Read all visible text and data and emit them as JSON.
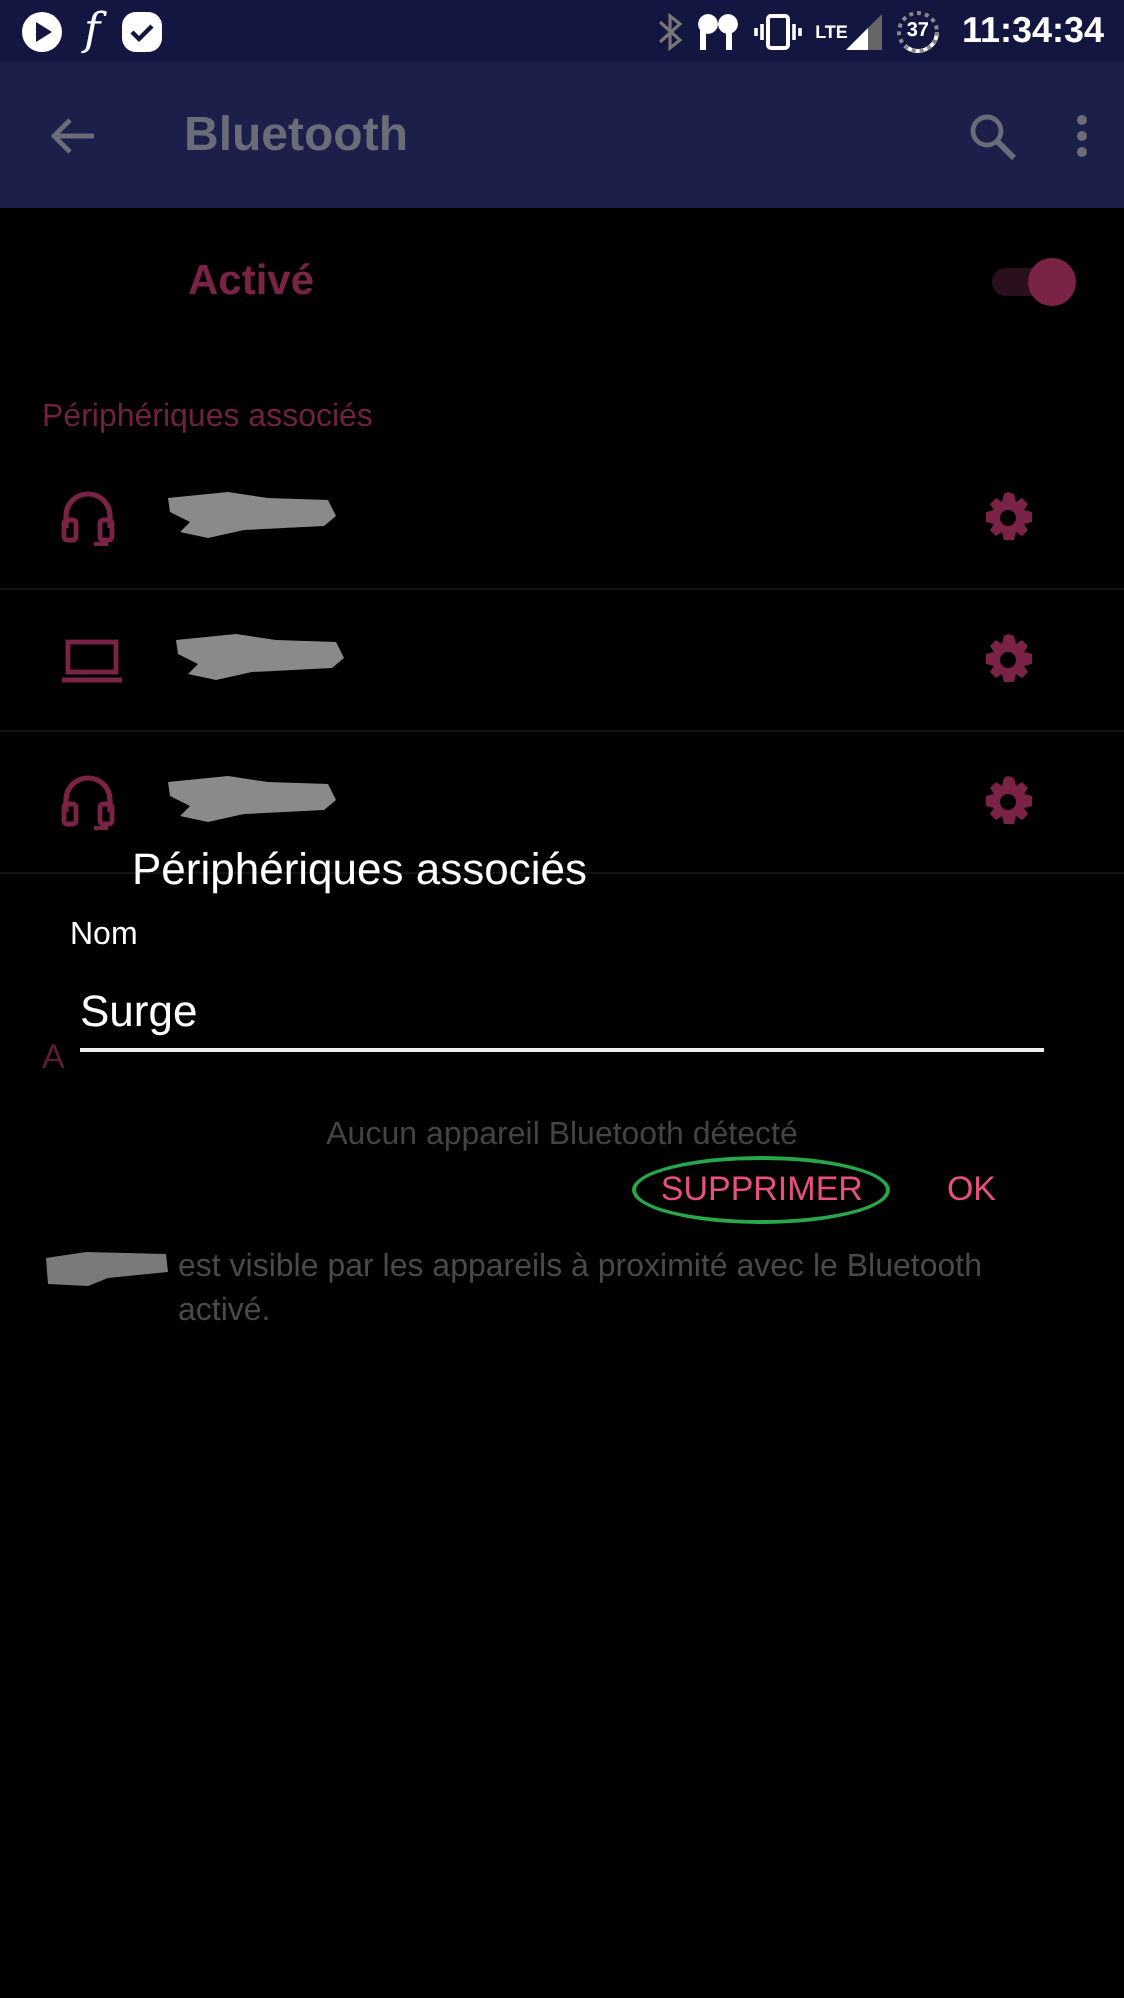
{
  "status_bar": {
    "notification_glyph": "f",
    "network": "LTE",
    "battery": "37",
    "time": "11:34:34"
  },
  "app_bar": {
    "title": "Bluetooth"
  },
  "master_switch": {
    "label": "Activé",
    "on": true
  },
  "paired_section": {
    "title": "Périphériques associés",
    "devices": [
      {
        "kind": "headphones"
      },
      {
        "kind": "laptop"
      },
      {
        "kind": "headphones"
      }
    ]
  },
  "available_section": {
    "title": "A",
    "empty_message": "Aucun appareil Bluetooth détecté"
  },
  "visibility_note": "est visible par les appareils à proximité avec le Bluetooth activé.",
  "dialog": {
    "title": "Périphériques associés",
    "field_label": "Nom",
    "field_value": "Surge",
    "buttons": [
      {
        "label": "SUPPRIMER",
        "highlighted": true
      },
      {
        "label": "OK",
        "highlighted": false
      }
    ]
  }
}
